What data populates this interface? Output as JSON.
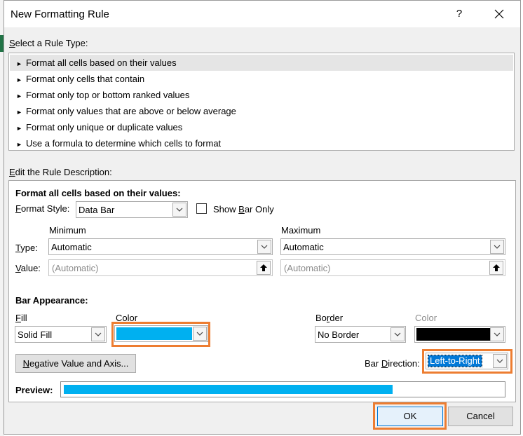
{
  "colors": {
    "accent_orange": "#ed7d31",
    "bar_fill": "#00b0f0",
    "border_color": "#000000",
    "sheet_green": "#217346"
  },
  "dialog": {
    "title": "New Formatting Rule",
    "help_label": "?"
  },
  "rule_type": {
    "label": "Select a Rule Type:",
    "items": [
      "Format all cells based on their values",
      "Format only cells that contain",
      "Format only top or bottom ranked values",
      "Format only values that are above or below average",
      "Format only unique or duplicate values",
      "Use a formula to determine which cells to format"
    ],
    "selected_index": 0
  },
  "description": {
    "label": "Edit the Rule Description:",
    "heading": "Format all cells based on their values:",
    "format_style_label": "Format Style:",
    "format_style_value": "Data Bar",
    "show_bar_only_label": "Show Bar Only",
    "show_bar_only_checked": false,
    "minimum_label": "Minimum",
    "maximum_label": "Maximum",
    "type_label": "Type:",
    "value_label": "Value:",
    "min_type": "Automatic",
    "max_type": "Automatic",
    "min_value": "(Automatic)",
    "max_value": "(Automatic)"
  },
  "bar_appearance": {
    "heading": "Bar Appearance:",
    "fill_label": "Fill",
    "fill_value": "Solid Fill",
    "color_label": "Color",
    "border_label": "Border",
    "border_value": "No Border",
    "border_color_label": "Color",
    "negative_button": "Negative Value and Axis...",
    "bar_direction_label": "Bar Direction:",
    "bar_direction_value": "Left-to-Right"
  },
  "preview": {
    "label": "Preview:",
    "fill_fraction": 0.75
  },
  "footer": {
    "ok_label": "OK",
    "cancel_label": "Cancel"
  }
}
